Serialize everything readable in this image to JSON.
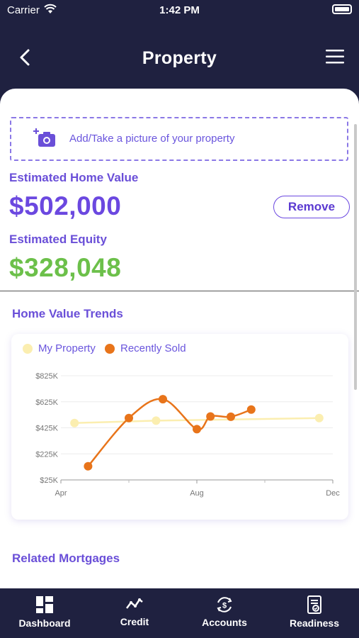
{
  "status": {
    "carrier": "Carrier",
    "time": "1:42 PM"
  },
  "nav": {
    "title": "Property"
  },
  "photo": {
    "label": "Add/Take a picture of your property"
  },
  "home": {
    "value_label": "Estimated Home Value",
    "value": "$502,000",
    "remove_label": "Remove",
    "equity_label": "Estimated Equity",
    "equity": "$328,048"
  },
  "colors": {
    "purple": "#6b48e0",
    "green": "#6cc04a",
    "navy": "#1f2140",
    "orange": "#e8741a",
    "pale_yellow": "#fbeeb0"
  },
  "trends": {
    "title": "Home Value Trends"
  },
  "chart_data": {
    "type": "line",
    "x_tick_labels": [
      "Apr",
      "Aug",
      "Dec"
    ],
    "y_tick_labels": [
      "$825K",
      "$625K",
      "$425K",
      "$225K",
      "$25K"
    ],
    "ylim": [
      25,
      825
    ],
    "y_unit": "K",
    "series": [
      {
        "name": "My Property",
        "color": "#fbeeb0",
        "points": [
          [
            0.5,
            462
          ],
          [
            3.5,
            480
          ],
          [
            9.5,
            500
          ]
        ]
      },
      {
        "name": "Recently Sold",
        "color": "#e8741a",
        "points": [
          [
            1.0,
            130
          ],
          [
            2.5,
            500
          ],
          [
            3.75,
            645
          ],
          [
            5.0,
            415
          ],
          [
            5.5,
            512
          ],
          [
            6.25,
            510
          ],
          [
            7.0,
            565
          ]
        ]
      }
    ],
    "x_domain": [
      0,
      10
    ],
    "grid": true,
    "legend": "top-left"
  },
  "mortgages": {
    "title": "Related Mortgages"
  },
  "tabs": [
    {
      "label": "Dashboard",
      "icon": "dashboard-icon"
    },
    {
      "label": "Credit",
      "icon": "trend-line-icon"
    },
    {
      "label": "Accounts",
      "icon": "dollar-cycle-icon"
    },
    {
      "label": "Readiness",
      "icon": "checklist-doc-icon"
    }
  ]
}
